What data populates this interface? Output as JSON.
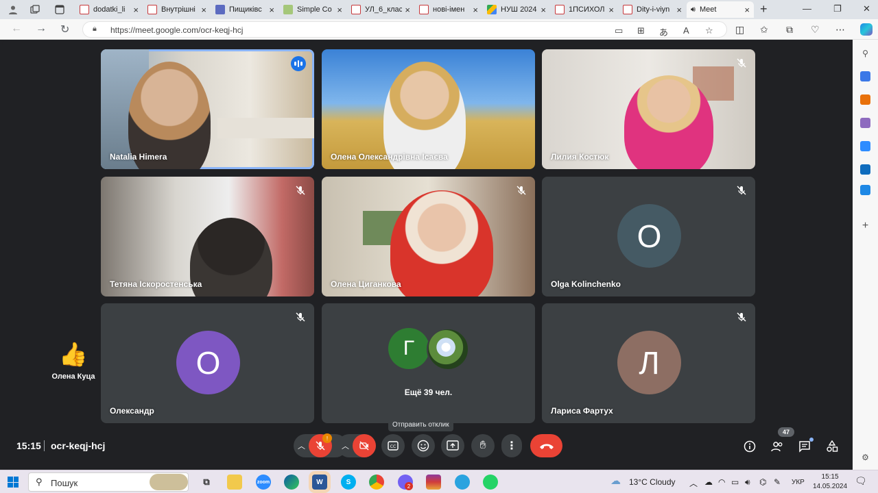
{
  "browser": {
    "tabs": [
      {
        "label": "dodatki_li",
        "favicon": "pdf"
      },
      {
        "label": "Внутрішні",
        "favicon": "pdf"
      },
      {
        "label": "Пищиківс",
        "favicon": "doc"
      },
      {
        "label": "Simple Co",
        "favicon": "img"
      },
      {
        "label": "УЛ_6_клас",
        "favicon": "pdf"
      },
      {
        "label": "нові-імен",
        "favicon": "pdf"
      },
      {
        "label": "НУШ 2024",
        "favicon": "drv"
      },
      {
        "label": "1ПСИХОЛ",
        "favicon": "pdf"
      },
      {
        "label": "Dity-i-viyn",
        "favicon": "pdf"
      },
      {
        "label": "Meet",
        "favicon": "meet",
        "active": true
      }
    ],
    "url": "https://meet.google.com/ocr-keqj-hcj"
  },
  "meet": {
    "participants": [
      {
        "name": "Natalia Himera",
        "type": "video",
        "speaking": true,
        "muted": false
      },
      {
        "name": "Олена Олександрівна Ісаєва",
        "type": "video",
        "muted": false
      },
      {
        "name": "Лилия Костюк",
        "type": "video",
        "muted": true
      },
      {
        "name": "Тетяна Іскоростенська",
        "type": "video",
        "muted": true
      },
      {
        "name": "Олена Циганкова",
        "type": "video",
        "muted": true
      },
      {
        "name": "Olga Kolinchenko",
        "type": "avatar",
        "initial": "O",
        "color": "#455a64",
        "muted": true
      },
      {
        "name": "Олександр",
        "type": "avatar",
        "initial": "О",
        "color": "#7e57c2",
        "muted": true
      },
      {
        "name": "Ещё 39 чел.",
        "type": "others",
        "initial": "Г",
        "color": "#2e7d32"
      },
      {
        "name": "Лариса Фартух",
        "type": "avatar",
        "initial": "Л",
        "color": "#8d6e63",
        "muted": true
      }
    ],
    "reaction": {
      "emoji": "👍",
      "name": "Олена Куца"
    },
    "tooltip": "Отправить отклик",
    "time": "15:15",
    "meeting_code": "ocr-keqj-hcj",
    "mic_badge": "!",
    "people_count": "47"
  },
  "taskbar": {
    "search_placeholder": "Пошук",
    "weather": "13°C  Cloudy",
    "lang": "УКР",
    "time": "15:15",
    "date": "14.05.2024",
    "viber_badge": "2"
  }
}
